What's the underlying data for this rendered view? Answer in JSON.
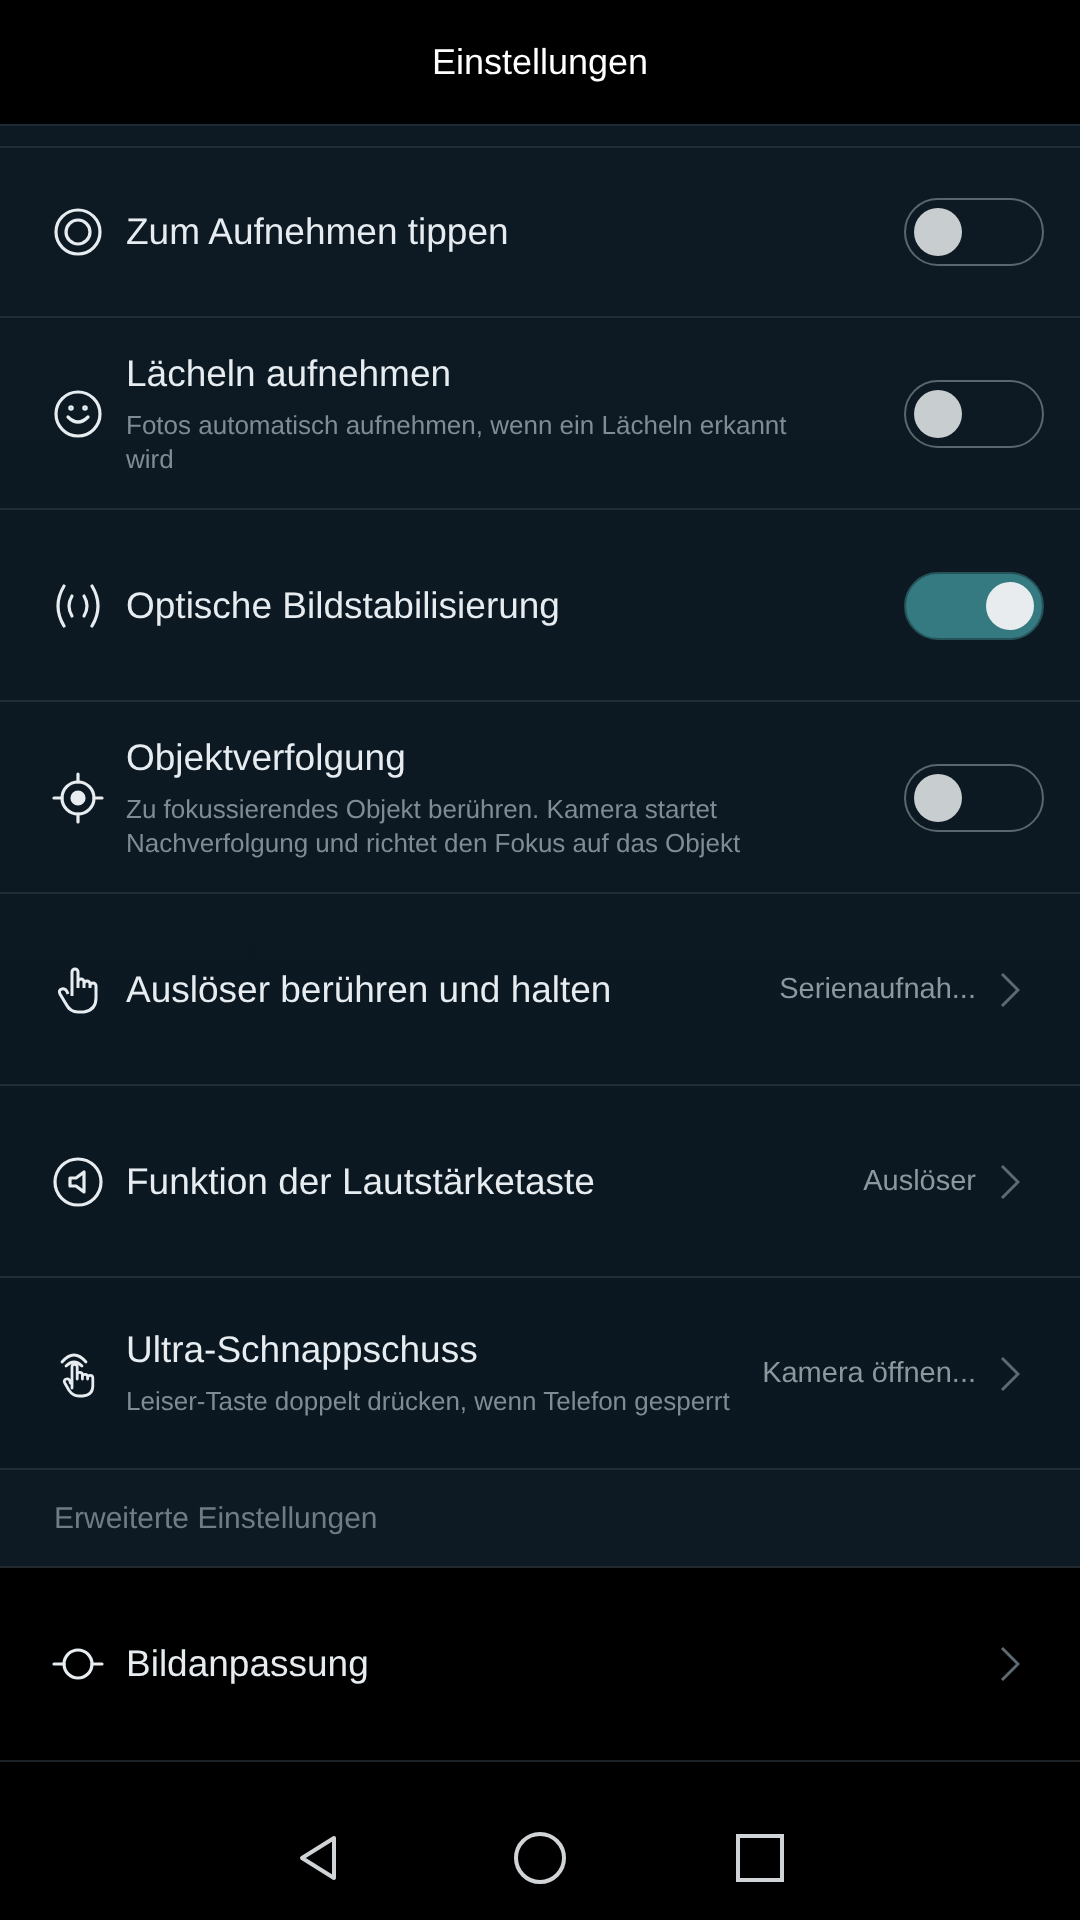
{
  "title": "Einstellungen",
  "items": [
    {
      "kind": "toggle",
      "title": "Zum Aufnehmen tippen",
      "on": false
    },
    {
      "kind": "toggle",
      "title": "Lächeln aufnehmen",
      "subtitle": "Fotos automatisch aufnehmen, wenn ein Lächeln erkannt wird",
      "on": false
    },
    {
      "kind": "toggle",
      "title": "Optische Bildstabilisierung",
      "on": true
    },
    {
      "kind": "toggle",
      "title": "Objektverfolgung",
      "subtitle": "Zu fokussierendes Objekt berühren. Kamera startet Nachverfolgung und richtet den Fokus auf das Objekt",
      "on": false
    },
    {
      "kind": "link",
      "title": "Auslöser berühren und halten",
      "value": "Serienaufnah..."
    },
    {
      "kind": "link",
      "title": "Funktion der Lautstärketaste",
      "value": "Auslöser"
    },
    {
      "kind": "link",
      "title": "Ultra-Schnappschuss",
      "subtitle": "Leiser-Taste doppelt drücken, wenn Telefon gesperrt",
      "value": "Kamera öffnen..."
    }
  ],
  "section": "Erweiterte Einstellungen",
  "advanced": [
    {
      "kind": "link",
      "title": "Bildanpassung"
    }
  ]
}
